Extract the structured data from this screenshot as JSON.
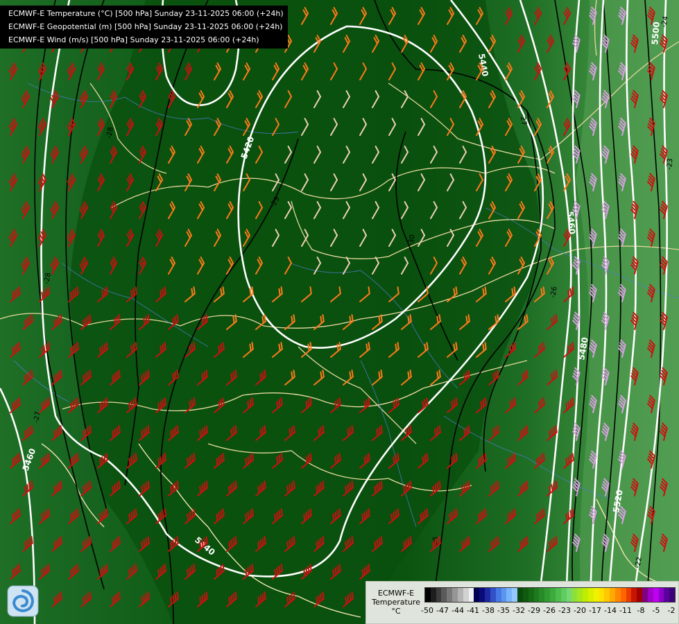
{
  "header": {
    "lines": [
      "ECMWF-E Temperature (°C) [500 hPa] Sunday 23-11-2025 06:00 (+24h)",
      "ECMWF-E Geopotential (m) [500 hPa] Sunday 23-11-2025 06:00 (+24h)",
      "ECMWF-E Wind (m/s) [500 hPa] Sunday 23-11-2025 06:00 (+24h)"
    ]
  },
  "map": {
    "geopotential_labels": [
      "5420",
      "5440",
      "5460",
      "5460",
      "5480",
      "5520",
      "5500",
      "5440"
    ],
    "temperature_labels": [
      "-28",
      "-28",
      "-27",
      "-27",
      "-26",
      "-25",
      "-24",
      "-23",
      "-22",
      "-29",
      "-30"
    ],
    "colors": {
      "background_cold": "#0b5410",
      "background_mid": "#1f6f26",
      "background_warm": "#4f9a50",
      "borders": "#e8d9a0",
      "rivers": "#4a7fd0",
      "geopotential_contour": "#ffffff",
      "temperature_contour": "#000000",
      "wind_light": "#f0d0b8",
      "wind_mid": "#ff7a1a",
      "wind_strong": "#cc1010",
      "wind_far": "#d8a0e0"
    }
  },
  "legend": {
    "title_lines": [
      "ECMWF-E",
      "Temperature",
      "°C"
    ],
    "tick_labels": [
      "-50",
      "-47",
      "-44",
      "-41",
      "-38",
      "-35",
      "-32",
      "-29",
      "-26",
      "-23",
      "-20",
      "-17",
      "-14",
      "-11",
      "-8",
      "-5",
      "-2"
    ],
    "colors": [
      "#000000",
      "#1e1e1e",
      "#3c3c3c",
      "#5a5a5a",
      "#787878",
      "#969696",
      "#b4b4b4",
      "#d2d2d2",
      "#f0f0f0",
      "#000050",
      "#0a0a78",
      "#1e28a0",
      "#3250c8",
      "#4678e6",
      "#5a96f0",
      "#78b4fa",
      "#96c8ff",
      "#0a4a0a",
      "#105a10",
      "#166a16",
      "#1e7a1e",
      "#288a28",
      "#329a32",
      "#3caa3c",
      "#4cbc4c",
      "#60cc60",
      "#74d874",
      "#8cdf3c",
      "#a6e61e",
      "#c0ec00",
      "#d8f000",
      "#f0f000",
      "#ffe000",
      "#ffc800",
      "#ffaa00",
      "#ff8800",
      "#ff6600",
      "#e83c00",
      "#c81400",
      "#a00000",
      "#800080",
      "#a000c8",
      "#c000f0",
      "#8c00c8",
      "#5a00a0",
      "#3c0078"
    ]
  }
}
